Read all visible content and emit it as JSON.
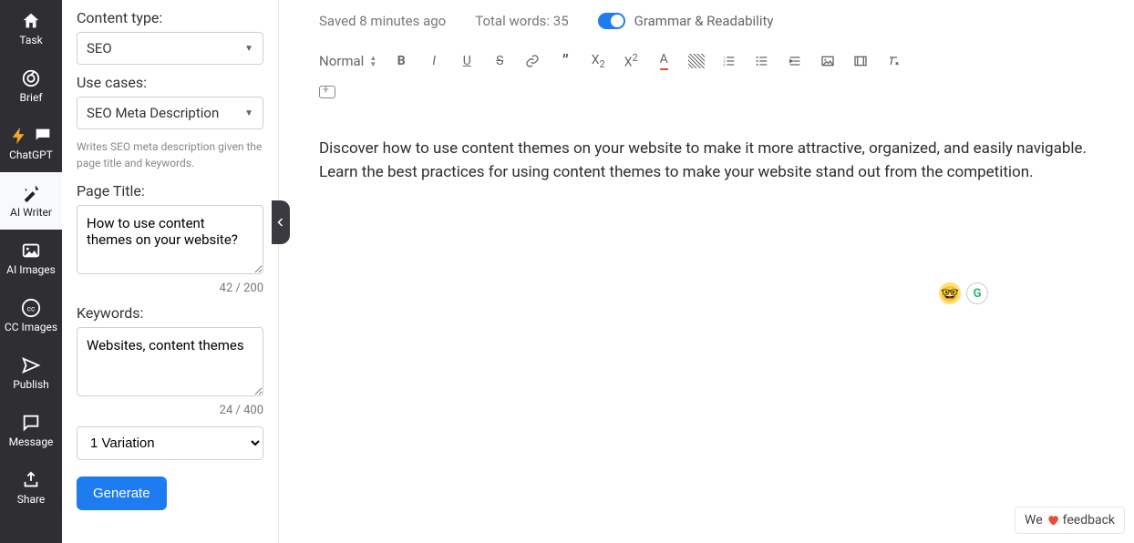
{
  "sidebar": {
    "items": [
      {
        "label": "Task"
      },
      {
        "label": "Brief"
      },
      {
        "label": "ChatGPT"
      },
      {
        "label": "AI Writer"
      },
      {
        "label": "AI Images"
      },
      {
        "label": "CC Images"
      },
      {
        "label": "Publish"
      },
      {
        "label": "Message"
      },
      {
        "label": "Share"
      }
    ]
  },
  "panel": {
    "content_type_label": "Content type:",
    "content_type_value": "SEO",
    "use_cases_label": "Use cases:",
    "use_cases_value": "SEO Meta Description",
    "use_cases_desc": "Writes SEO meta description given the page title and keywords.",
    "page_title_label": "Page Title:",
    "page_title_value": "How to use content themes on your website?",
    "page_title_counter": "42 / 200",
    "keywords_label": "Keywords:",
    "keywords_value": "Websites, content themes",
    "keywords_counter": "24 / 400",
    "variation_value": "1 Variation",
    "generate_label": "Generate"
  },
  "editor": {
    "saved_status": "Saved 8 minutes ago",
    "word_count": "Total words: 35",
    "grammar_label": "Grammar & Readability",
    "normal_label": "Normal",
    "body": "Discover how to use content themes on your website to make it more attractive, organized, and easily navigable. Learn the best practices for using content themes to make your website stand out from the competition."
  },
  "feedback": {
    "prefix": "We",
    "suffix": "feedback"
  }
}
